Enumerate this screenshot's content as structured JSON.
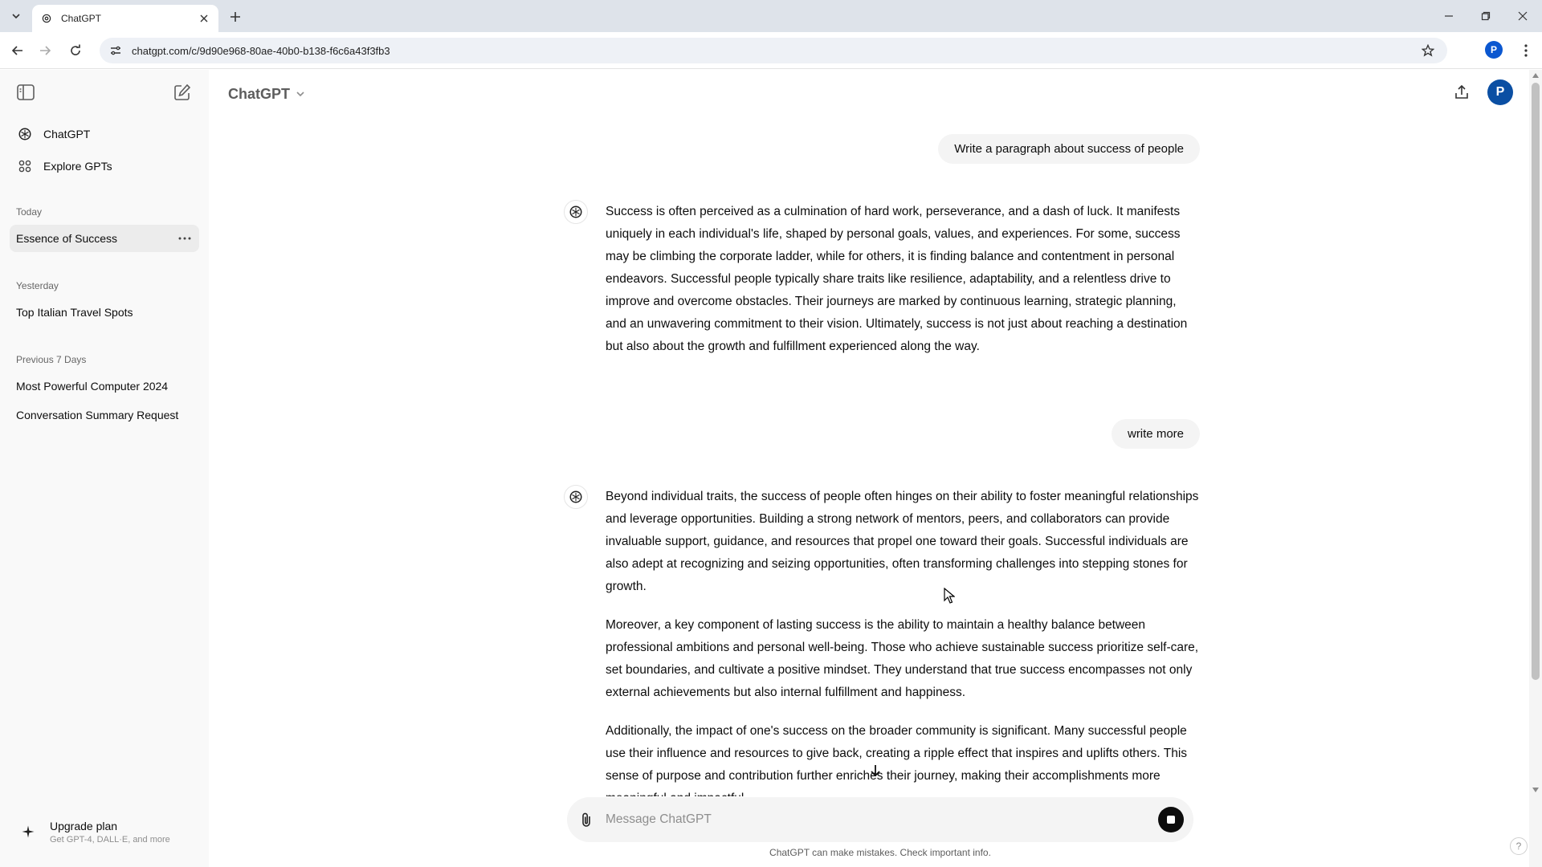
{
  "browser": {
    "tab_title": "ChatGPT",
    "url": "chatgpt.com/c/9d90e968-80ae-40b0-b138-f6c6a43f3fb3",
    "profile_initial": "P"
  },
  "sidebar": {
    "nav": [
      {
        "label": "ChatGPT",
        "icon": "openai-logo-icon"
      },
      {
        "label": "Explore GPTs",
        "icon": "grid-icon"
      }
    ],
    "sections": [
      {
        "title": "Today",
        "items": [
          "Essence of Success"
        ]
      },
      {
        "title": "Yesterday",
        "items": [
          "Top Italian Travel Spots"
        ]
      },
      {
        "title": "Previous 7 Days",
        "items": [
          "Most Powerful Computer 2024",
          "Conversation Summary Request"
        ]
      }
    ],
    "upgrade": {
      "title": "Upgrade plan",
      "subtitle": "Get GPT-4, DALL·E, and more"
    }
  },
  "header": {
    "model": "ChatGPT",
    "avatar_initial": "P"
  },
  "conversation": {
    "user_1": "Write a paragraph about success of people",
    "bot_1": "Success is often perceived as a culmination of hard work, perseverance, and a dash of luck. It manifests uniquely in each individual's life, shaped by personal goals, values, and experiences. For some, success may be climbing the corporate ladder, while for others, it is finding balance and contentment in personal endeavors. Successful people typically share traits like resilience, adaptability, and a relentless drive to improve and overcome obstacles. Their journeys are marked by continuous learning, strategic planning, and an unwavering commitment to their vision. Ultimately, success is not just about reaching a destination but also about the growth and fulfillment experienced along the way.",
    "user_2": "write more",
    "bot_2_p1": "Beyond individual traits, the success of people often hinges on their ability to foster meaningful relationships and leverage opportunities. Building a strong network of mentors, peers, and collaborators can provide invaluable support, guidance, and resources that propel one toward their goals. Successful individuals are also adept at recognizing and seizing opportunities, often transforming challenges into stepping stones for growth.",
    "bot_2_p2": "Moreover, a key component of lasting success is the ability to maintain a healthy balance between professional ambitions and personal well-being. Those who achieve sustainable success prioritize self-care, set boundaries, and cultivate a positive mindset. They understand that true success encompasses not only external achievements but also internal fulfillment and happiness.",
    "bot_2_p3": "Additionally, the impact of one's success on the broader community is significant. Many successful people use their influence and resources to give back, creating a ripple effect that inspires and uplifts others. This sense of purpose and contribution further enriches their journey, making their accomplishments more meaningful and impactful."
  },
  "composer": {
    "placeholder": "Message ChatGPT",
    "value": ""
  },
  "footer": {
    "disclaimer": "ChatGPT can make mistakes. Check important info.",
    "help": "?"
  }
}
